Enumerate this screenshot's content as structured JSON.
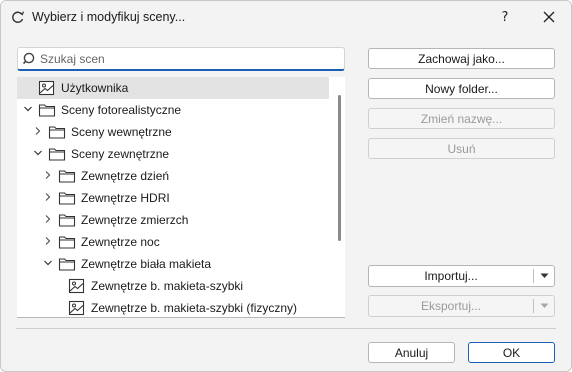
{
  "window": {
    "title": "Wybierz i modyfikuj sceny...",
    "help_label": "?",
    "close_label": "✕"
  },
  "search": {
    "placeholder": "Szukaj scen"
  },
  "tree": {
    "items": [
      {
        "label": "Użytkownika",
        "type": "scene",
        "selected": true
      },
      {
        "label": "Sceny fotorealistyczne",
        "type": "folder",
        "expanded": true
      },
      {
        "label": "Sceny wewnętrzne",
        "type": "folder",
        "expanded": false
      },
      {
        "label": "Sceny zewnętrzne",
        "type": "folder",
        "expanded": true
      },
      {
        "label": "Zewnętrze dzień",
        "type": "folder",
        "expanded": false
      },
      {
        "label": "Zewnętrze HDRI",
        "type": "folder",
        "expanded": false
      },
      {
        "label": "Zewnętrze zmierzch",
        "type": "folder",
        "expanded": false
      },
      {
        "label": "Zewnętrze noc",
        "type": "folder",
        "expanded": false
      },
      {
        "label": "Zewnętrze biała makieta",
        "type": "folder",
        "expanded": true
      },
      {
        "label": "Zewnętrze b. makieta-szybki",
        "type": "scene"
      },
      {
        "label": "Zewnętrze b. makieta-szybki (fizyczny)",
        "type": "scene"
      }
    ]
  },
  "actions": {
    "save_as": "Zachowaj jako...",
    "new_folder": "Nowy folder...",
    "rename": "Zmień nazwę...",
    "delete": "Usuń",
    "import": "Importuj...",
    "export": "Eksportuj..."
  },
  "footer": {
    "cancel": "Anuluj",
    "ok": "OK"
  },
  "colors": {
    "accent": "#1a5fb4",
    "selected_row": "#e3e3e3",
    "disabled_text": "#9a9a9a"
  }
}
